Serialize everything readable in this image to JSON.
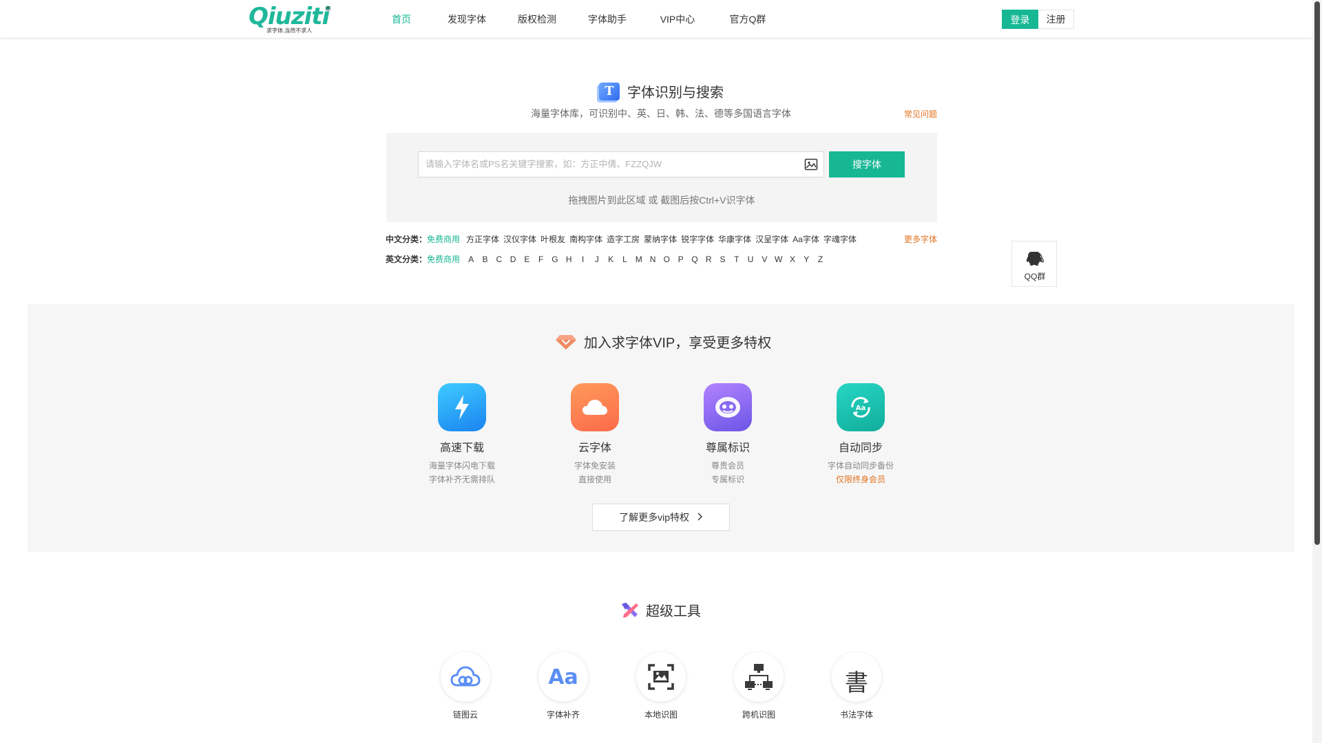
{
  "header": {
    "logo": {
      "word": "Qiuziti",
      "reg": "®",
      "tagline": "求字体,当然不求人"
    },
    "nav": [
      {
        "label": "首页",
        "active": true
      },
      {
        "label": "发现字体",
        "active": false
      },
      {
        "label": "版权检测",
        "active": false
      },
      {
        "label": "字体助手",
        "active": false
      },
      {
        "label": "VIP中心",
        "active": false
      },
      {
        "label": "官方Q群",
        "active": false
      }
    ],
    "login_label": "登录",
    "register_label": "注册"
  },
  "search": {
    "title": "字体识别与搜索",
    "title_icon": "T",
    "subtitle": "海量字体库，可识别中、英、日、韩、法、德等多国语言字体",
    "faq_label": "常见问题",
    "placeholder": "请输入字体名或PS名关键字搜索，如：方正中倩、FZZQJW",
    "button_label": "搜字体",
    "drag_hint": "拖拽图片到此区域 或 截图后按Ctrl+V识字体"
  },
  "categories": {
    "cn_label": "中文分类：",
    "cn_free": "免费商用",
    "cn_items": [
      "方正字体",
      "汉仪字体",
      "叶根友",
      "南构字体",
      "造字工房",
      "蒙纳字体",
      "锐字字体",
      "华康字体",
      "汉呈字体",
      "Aa字体",
      "字魂字体"
    ],
    "more_label": "更多字体",
    "en_label": "英文分类：",
    "en_free": "免费商用",
    "en_letters": [
      "A",
      "B",
      "C",
      "D",
      "E",
      "F",
      "G",
      "H",
      "I",
      "J",
      "K",
      "L",
      "M",
      "N",
      "O",
      "P",
      "Q",
      "R",
      "S",
      "T",
      "U",
      "V",
      "W",
      "X",
      "Y",
      "Z"
    ]
  },
  "qq_float": {
    "label": "QQ群"
  },
  "vip": {
    "title": "加入求字体VIP，享受更多特权",
    "cards": [
      {
        "name": "高速下载",
        "desc1": "海量字体闪电下载",
        "desc2": "字体补齐无需排队",
        "icon": "lightning-icon"
      },
      {
        "name": "云字体",
        "desc1": "字体免安装",
        "desc2": "直接使用",
        "icon": "cloud-icon"
      },
      {
        "name": "尊属标识",
        "desc1": "尊贵会员",
        "desc2": "专属标识",
        "icon": "badge-icon"
      },
      {
        "name": "自动同步",
        "desc1": "字体自动同步备份",
        "desc2": "仅限终身会员",
        "icon": "sync-icon"
      }
    ],
    "more_label": "了解更多vip特权"
  },
  "tools": {
    "title": "超级工具",
    "items": [
      {
        "label": "链图云",
        "icon": "chain-cloud-icon"
      },
      {
        "label": "字体补齐",
        "icon": "aa-icon"
      },
      {
        "label": "本地识图",
        "icon": "local-image-icon"
      },
      {
        "label": "跨机识图",
        "icon": "network-icon"
      },
      {
        "label": "书法字体",
        "icon": "calligraphy-icon"
      }
    ]
  },
  "colors": {
    "brand": "#17b794",
    "accent_orange": "#e0721f"
  }
}
